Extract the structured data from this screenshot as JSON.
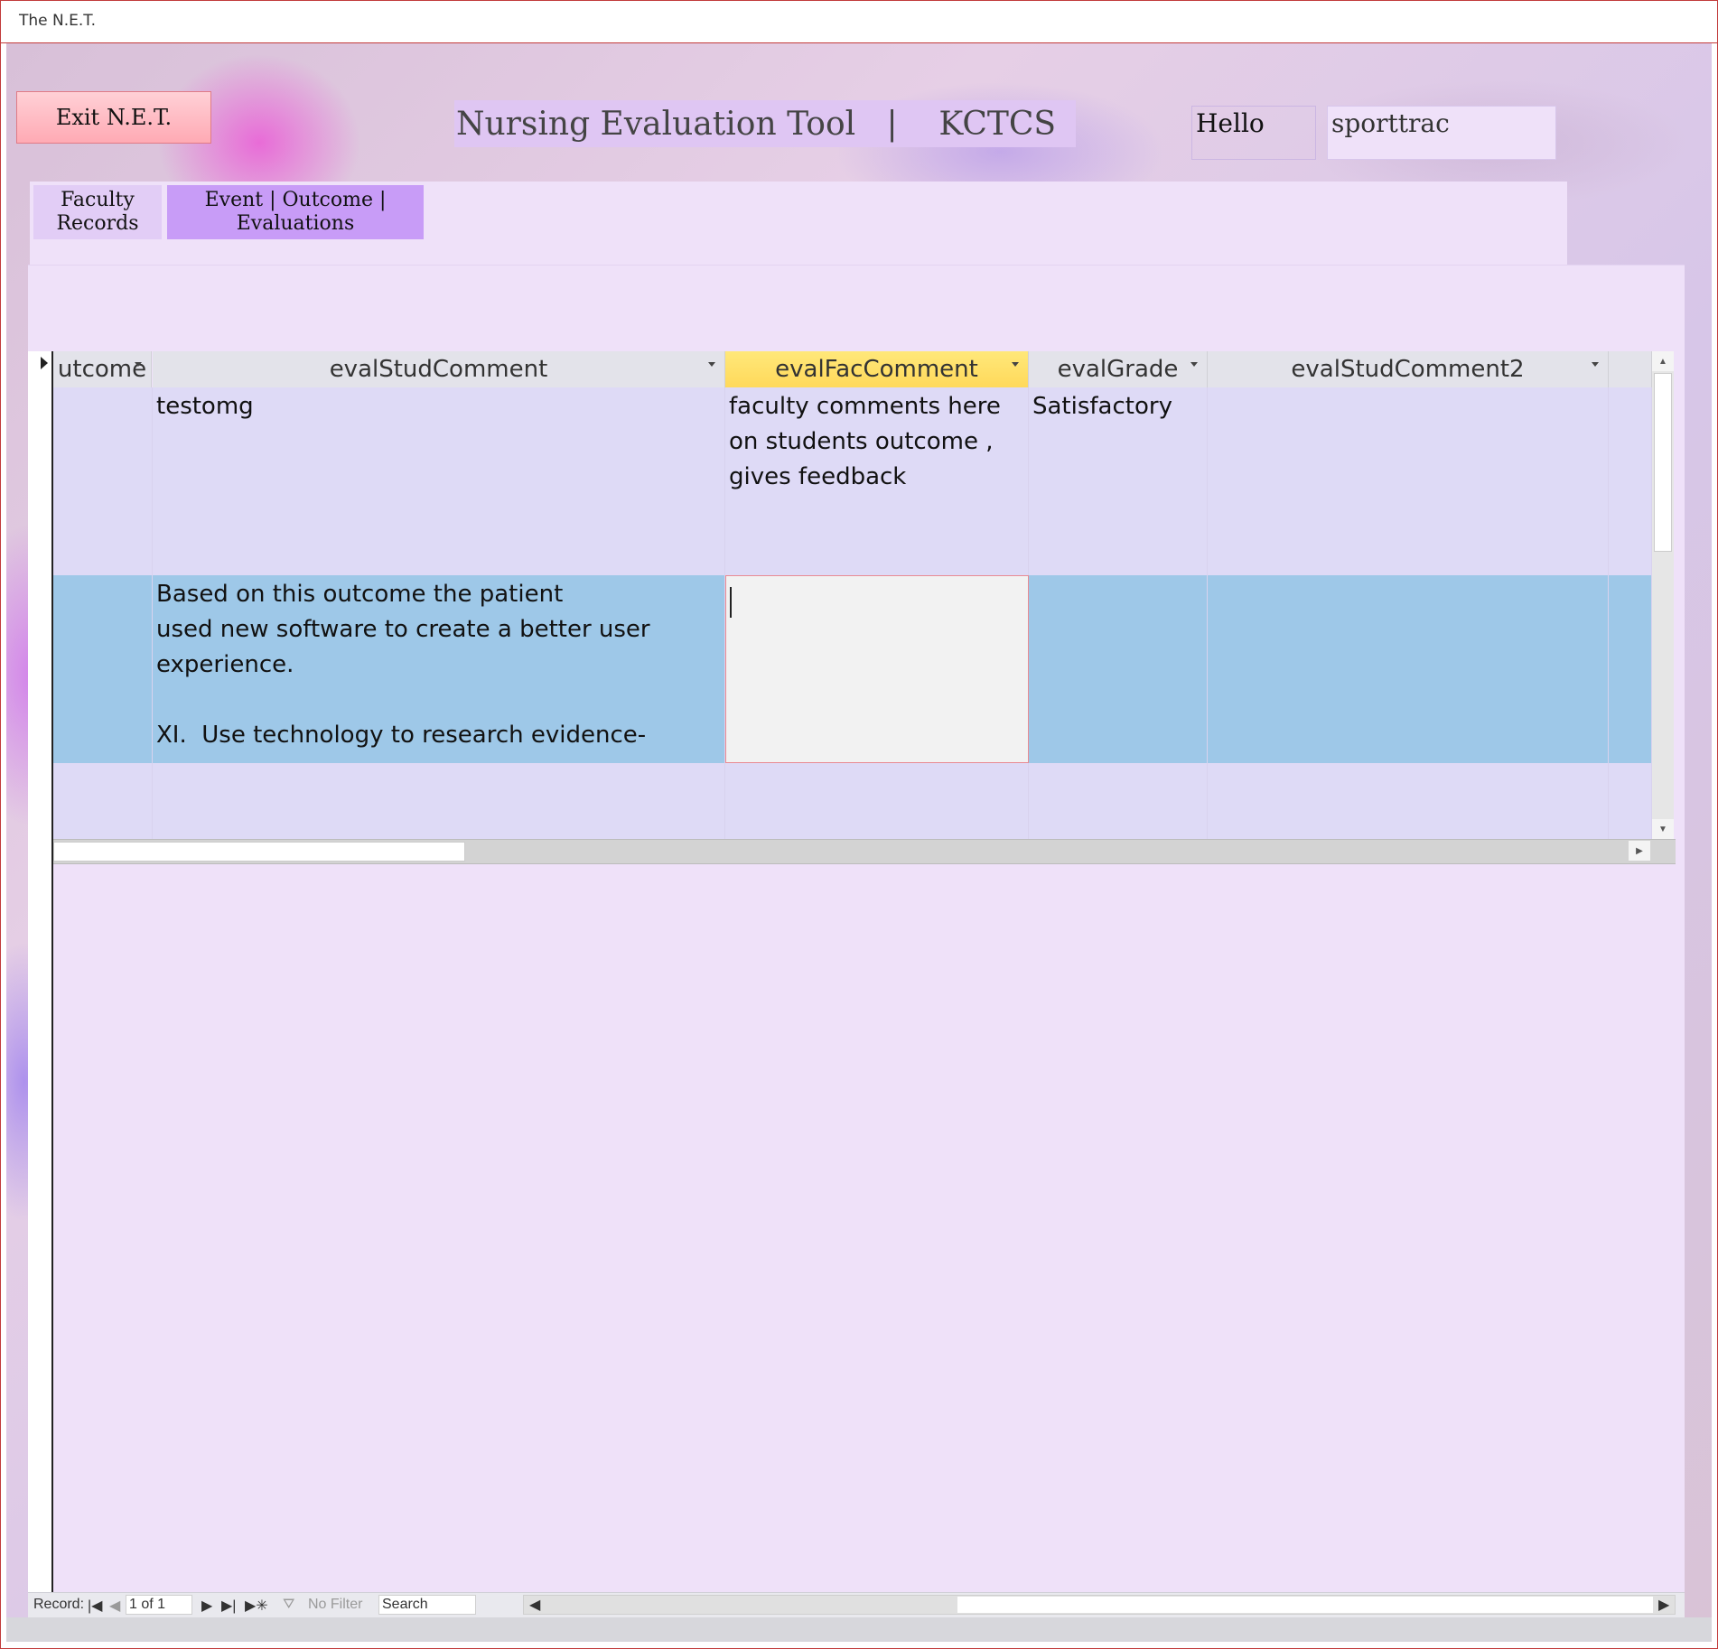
{
  "window": {
    "title": "The N.E.T."
  },
  "header": {
    "exit_label": "Exit N.E.T.",
    "app_title": "Nursing Evaluation Tool   |    KCTCS",
    "hello_label": "Hello",
    "username": "sporttrac"
  },
  "tabs": [
    {
      "label_line1": "Faculty",
      "label_line2": "Records"
    },
    {
      "label_line1": "Event | Outcome |",
      "label_line2": "Evaluations"
    }
  ],
  "grid": {
    "columns": [
      "utcome",
      "evalStudComment",
      "evalFacComment",
      "evalGrade",
      "evalStudComment2"
    ],
    "selected_column": "evalFacComment",
    "rows": [
      {
        "outcome": "",
        "evalStudComment": "testomg",
        "evalFacComment": "faculty comments here\non students outcome ,\ngives feedback",
        "evalGrade": "Satisfactory",
        "evalStudComment2": ""
      },
      {
        "outcome": "",
        "evalStudComment": "Based on this outcome the patient\nused new software to create a better user\nexperience.\n\nXI.  Use technology to research evidence-",
        "evalFacComment": "",
        "evalGrade": "",
        "evalStudComment2": ""
      },
      {
        "outcome": "",
        "evalStudComment": "",
        "evalFacComment": "",
        "evalGrade": "",
        "evalStudComment2": ""
      }
    ]
  },
  "navigation": {
    "record_label": "Record:",
    "record_position": "1 of 1",
    "filter_label": "No Filter",
    "search_placeholder": "Search"
  },
  "icons": [
    "record-selector-arrow-icon",
    "first-record-icon",
    "prev-record-icon",
    "next-record-icon",
    "last-record-icon",
    "new-record-icon",
    "filter-icon",
    "scroll-up-icon",
    "scroll-down-icon",
    "scroll-left-icon",
    "scroll-right-icon",
    "dropdown-arrow-icon"
  ],
  "colors": {
    "accent_tab": "#c89cf7",
    "selected_header": "#ffd95a",
    "selected_row": "#9ec8e8",
    "window_border": "#c23b3b"
  }
}
